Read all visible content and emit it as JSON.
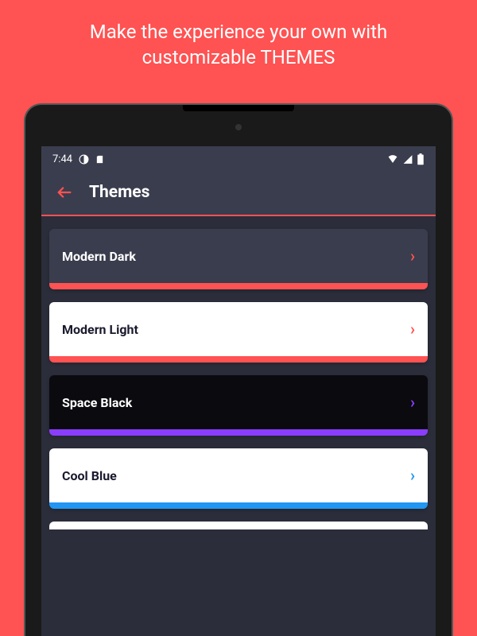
{
  "promo": {
    "line1": "Make the experience your own with",
    "line2": "customizable THEMES"
  },
  "status_bar": {
    "time": "7:44"
  },
  "header": {
    "title": "Themes"
  },
  "themes": [
    {
      "name": "Modern Dark",
      "bg": "#3a3d4d",
      "text": "#ffffff",
      "accent": "#ff5252"
    },
    {
      "name": "Modern Light",
      "bg": "#ffffff",
      "text": "#1a1a2e",
      "accent": "#ff5252"
    },
    {
      "name": "Space Black",
      "bg": "#0a0a0f",
      "text": "#ffffff",
      "accent": "#8b3dff"
    },
    {
      "name": "Cool Blue",
      "bg": "#ffffff",
      "text": "#1a1a2e",
      "accent": "#2196f3"
    }
  ],
  "colors": {
    "page_bg": "#ff5252",
    "screen_bg": "#2b2d3a",
    "header_bg": "#3a3d4d"
  }
}
